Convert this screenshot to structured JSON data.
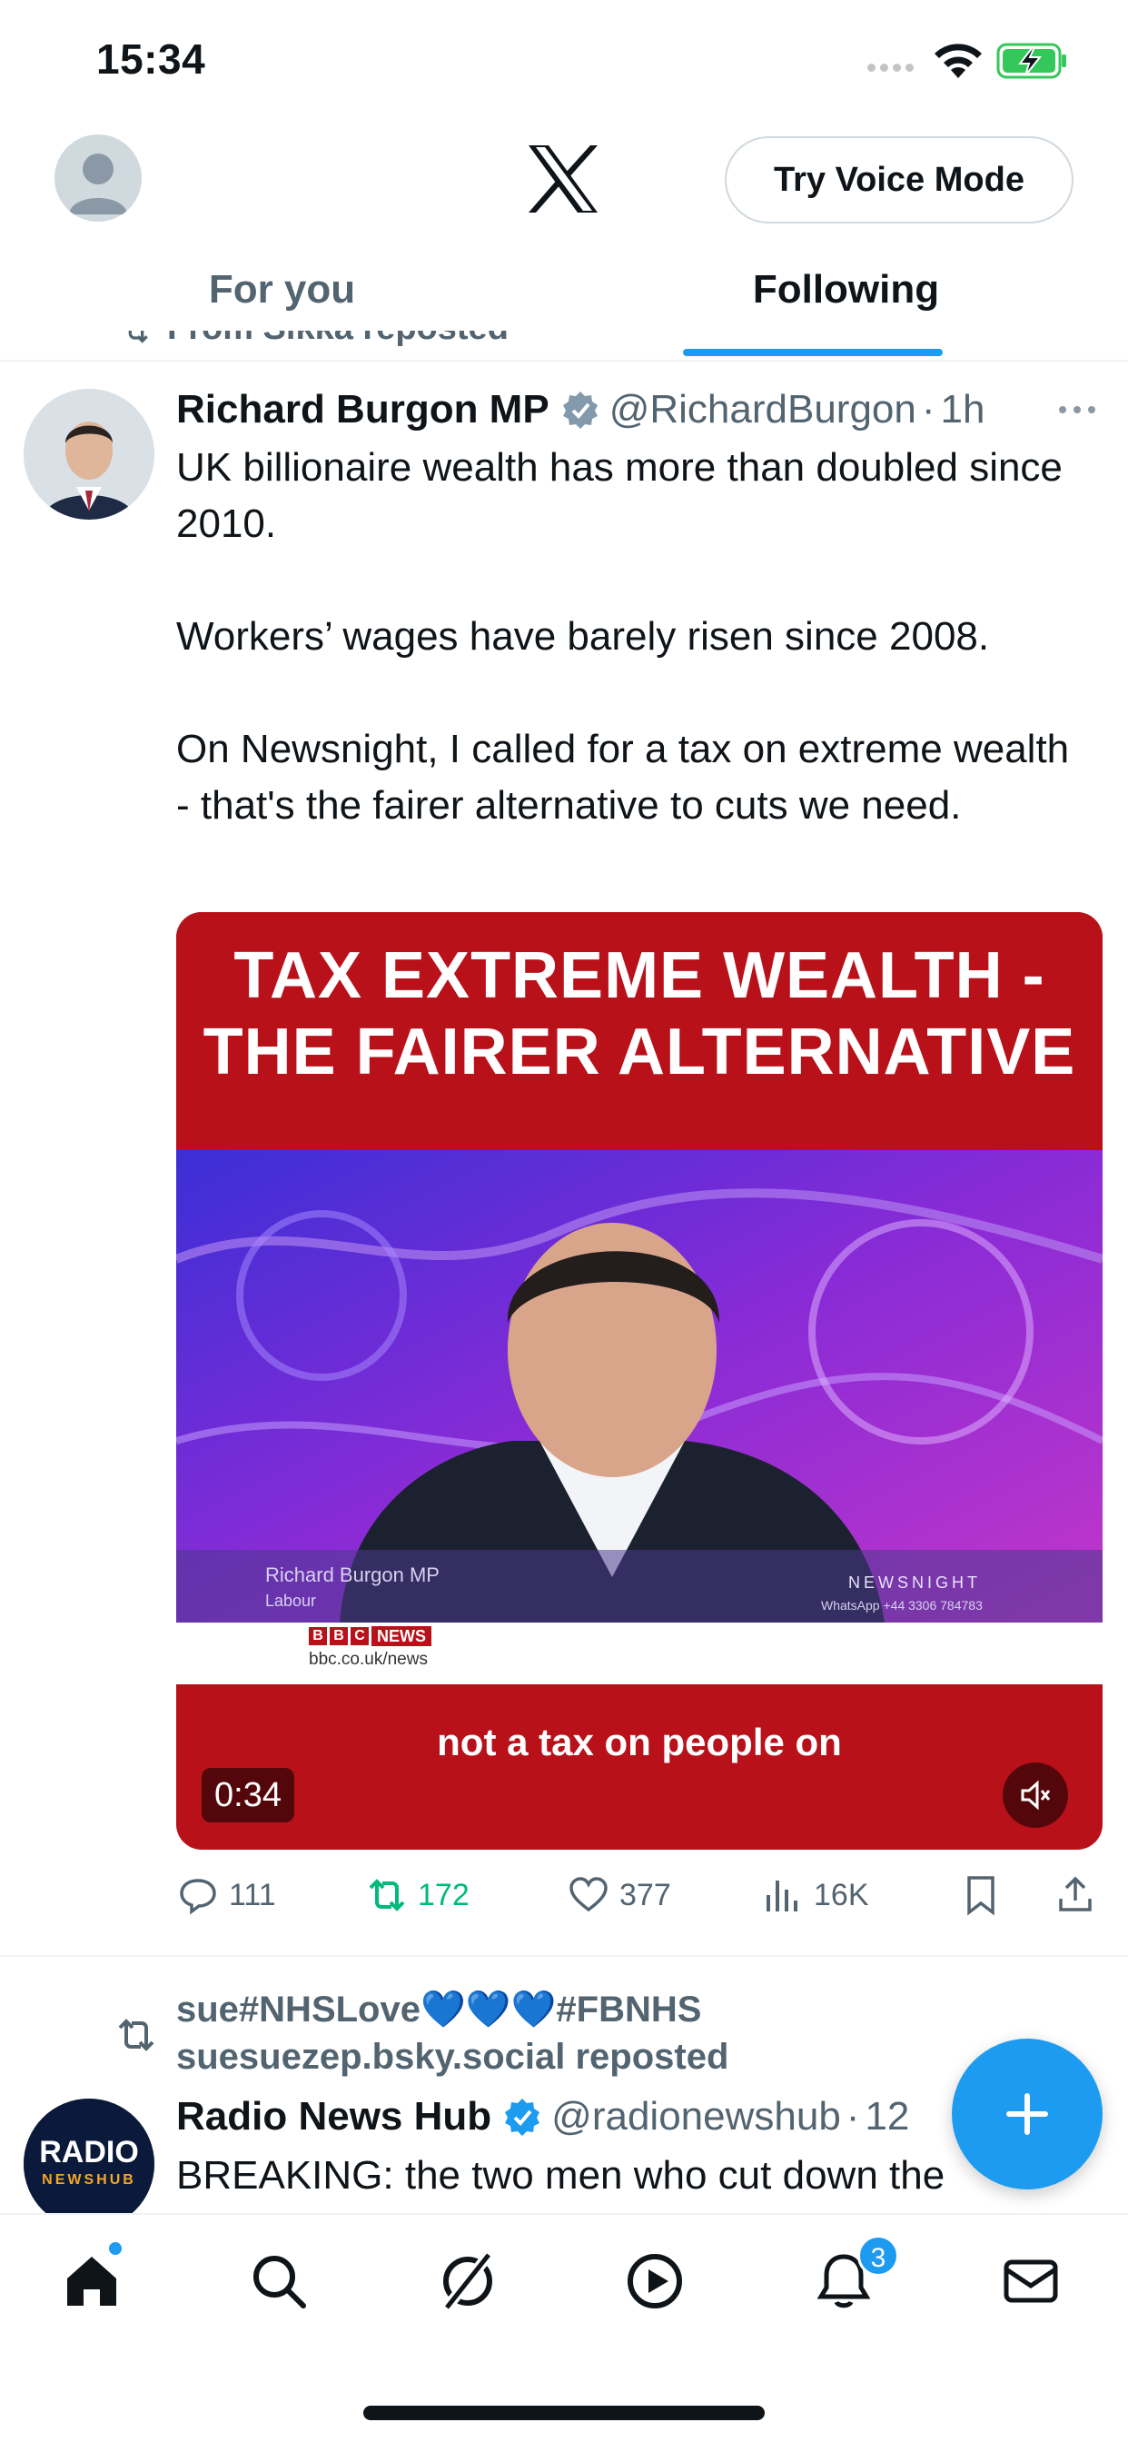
{
  "status_bar": {
    "time": "15:34"
  },
  "header": {
    "voice_button_label": "Try Voice Mode",
    "tabs": [
      {
        "label": "For you",
        "active": false
      },
      {
        "label": "Following",
        "active": true
      }
    ]
  },
  "feed": {
    "clipped_repost_text": "From Sikka reposted",
    "tweet1": {
      "name": "Richard Burgon MP",
      "handle": "@RichardBurgon",
      "separator": "·",
      "time": "1h",
      "paragraphs": [
        "UK billionaire wealth has more than doubled since 2010.",
        "Workers’ wages have barely risen since 2008.",
        "On Newsnight, I called for a tax on extreme wealth - that's the fairer alternative to cuts we need."
      ],
      "media": {
        "headline_line1": "TAX EXTREME WEALTH -",
        "headline_line2": "THE FAIRER ALTERNATIVE",
        "lower_third_name": "Richard Burgon MP",
        "lower_third_party": "Labour",
        "programme_logo": "NEWSNIGHT",
        "whatsapp": "WhatsApp +44 3306 784783",
        "bbc_label": "NEWS",
        "bbc_url": "bbc.co.uk/news",
        "subtitle": "not a tax on people on",
        "duration": "0:34"
      },
      "actions": {
        "replies": "111",
        "reposts": "172",
        "likes": "377",
        "views": "16K"
      }
    },
    "tweet2": {
      "repost_line1": "sue#NHSLove",
      "repost_hearts": "💙💙💙",
      "repost_line1_tail": "#FBNHS",
      "repost_line2": "suesuezep.bsky.social reposted",
      "name": "Radio News Hub",
      "handle": "@radionewshub",
      "separator": "·",
      "time": "12",
      "text": "BREAKING: the two men who cut down the",
      "avatar_text_top": "RADIO",
      "avatar_text_bottom": "NEWSHUB"
    }
  },
  "bottom_nav": {
    "notifications_count": "3"
  },
  "colors": {
    "accent": "#1d9bf0",
    "retweet_green": "#00ba7c",
    "secondary_text": "#536471",
    "bbc_red": "#b8111a"
  }
}
